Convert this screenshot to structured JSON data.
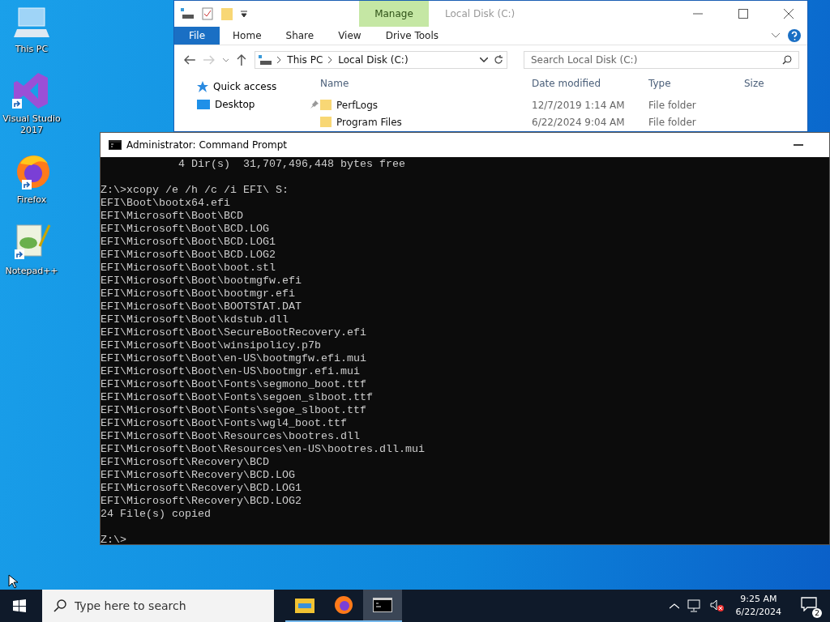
{
  "desktop_icons": [
    {
      "label": "This PC",
      "kind": "pc",
      "shortcut": false
    },
    {
      "label": "Visual Studio\n2017",
      "kind": "vs",
      "shortcut": true
    },
    {
      "label": "Firefox",
      "kind": "firefox",
      "shortcut": true
    },
    {
      "label": "Notepad++",
      "kind": "notepad",
      "shortcut": true
    }
  ],
  "explorer": {
    "title": "Local Disk (C:)",
    "context_tab": "Manage",
    "ribbon_tabs": [
      {
        "label": "File",
        "selected": true
      },
      {
        "label": "Home",
        "selected": false
      },
      {
        "label": "Share",
        "selected": false
      },
      {
        "label": "View",
        "selected": false
      },
      {
        "label": "Drive Tools",
        "selected": false
      }
    ],
    "breadcrumb": [
      "This PC",
      "Local Disk (C:)"
    ],
    "search": {
      "placeholder": "Search Local Disk (C:)"
    },
    "nav_items": [
      {
        "label": "Quick access",
        "kind": "star",
        "pinned": false
      },
      {
        "label": "Desktop",
        "kind": "desktop",
        "pinned": true
      }
    ],
    "columns": [
      "Name",
      "Date modified",
      "Type",
      "Size"
    ],
    "rows": [
      {
        "name": "PerfLogs",
        "date": "12/7/2019 1:14 AM",
        "type": "File folder"
      },
      {
        "name": "Program Files",
        "date": "6/22/2024 9:04 AM",
        "type": "File folder"
      }
    ]
  },
  "console": {
    "title": "Administrator: Command Prompt",
    "blocks": [
      [
        "            4 Dir(s)  31,707,496,448 bytes free"
      ],
      [
        "Z:\\>xcopy /e /h /c /i EFI\\ S:",
        "EFI\\Boot\\bootx64.efi",
        "EFI\\Microsoft\\Boot\\BCD",
        "EFI\\Microsoft\\Boot\\BCD.LOG",
        "EFI\\Microsoft\\Boot\\BCD.LOG1",
        "EFI\\Microsoft\\Boot\\BCD.LOG2",
        "EFI\\Microsoft\\Boot\\boot.stl",
        "EFI\\Microsoft\\Boot\\bootmgfw.efi",
        "EFI\\Microsoft\\Boot\\bootmgr.efi",
        "EFI\\Microsoft\\Boot\\BOOTSTAT.DAT",
        "EFI\\Microsoft\\Boot\\kdstub.dll",
        "EFI\\Microsoft\\Boot\\SecureBootRecovery.efi",
        "EFI\\Microsoft\\Boot\\winsipolicy.p7b",
        "EFI\\Microsoft\\Boot\\en-US\\bootmgfw.efi.mui",
        "EFI\\Microsoft\\Boot\\en-US\\bootmgr.efi.mui",
        "EFI\\Microsoft\\Boot\\Fonts\\segmono_boot.ttf",
        "EFI\\Microsoft\\Boot\\Fonts\\segoen_slboot.ttf",
        "EFI\\Microsoft\\Boot\\Fonts\\segoe_slboot.ttf",
        "EFI\\Microsoft\\Boot\\Fonts\\wgl4_boot.ttf",
        "EFI\\Microsoft\\Boot\\Resources\\bootres.dll",
        "EFI\\Microsoft\\Boot\\Resources\\en-US\\bootres.dll.mui",
        "EFI\\Microsoft\\Recovery\\BCD",
        "EFI\\Microsoft\\Recovery\\BCD.LOG",
        "EFI\\Microsoft\\Recovery\\BCD.LOG1",
        "EFI\\Microsoft\\Recovery\\BCD.LOG2",
        "24 File(s) copied"
      ],
      [
        "Z:\\>"
      ]
    ]
  },
  "taskbar": {
    "search": {
      "placeholder": "Type here to search"
    },
    "apps": [
      {
        "kind": "explorer",
        "selected": false
      },
      {
        "kind": "firefox",
        "selected": false
      },
      {
        "kind": "cmd",
        "selected": true
      }
    ],
    "time": "9:25 AM",
    "date": "6/22/2024",
    "notifications": "2"
  }
}
